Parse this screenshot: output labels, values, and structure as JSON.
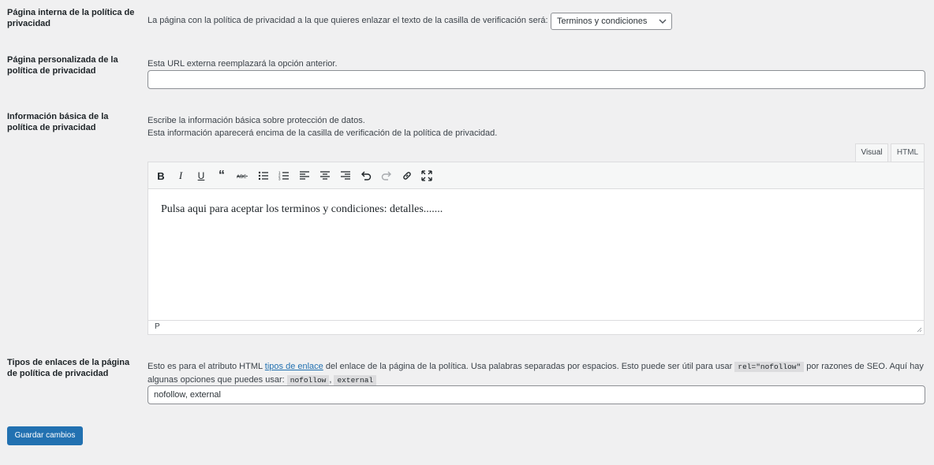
{
  "rows": {
    "internal_page": {
      "label": "Página interna de la política de privacidad",
      "description": "La página con la política de privacidad a la que quieres enlazar el texto de la casilla de verificación será:",
      "select_value": "Terminos y condiciones"
    },
    "custom_page": {
      "label": "Página personalizada de la política de privacidad",
      "description": "Esta URL externa reemplazará la opción anterior.",
      "input_value": ""
    },
    "basic_info": {
      "label": "Información básica de la política de privacidad",
      "description_line1": "Escribe la información básica sobre protección de datos.",
      "description_line2": "Esta información aparecerá encima de la casilla de verificación de la política de privacidad.",
      "tabs": [
        "Visual",
        "HTML"
      ],
      "editor_content": "Pulsa aqui para aceptar los terminos y condiciones: detalles.......",
      "status_path": "P"
    },
    "link_types": {
      "label": "Tipos de enlaces de la página de política de privacidad",
      "desc_part1": "Esto es para el atributo HTML ",
      "desc_link": "tipos de enlace",
      "desc_part2": " del enlace de la página de la política. Usa palabras separadas por espacios. Esto puede ser útil para usar ",
      "desc_code1": "rel=\"nofollow\"",
      "desc_part3": " por razones de SEO. Aquí hay algunas opciones que puedes usar: ",
      "desc_code2": "nofollow",
      "desc_sep": ", ",
      "desc_code3": "external",
      "input_value": "nofollow, external"
    }
  },
  "save_button": "Guardar cambios",
  "colors": {
    "accent": "#2271b1",
    "background": "#f0f0f1"
  }
}
